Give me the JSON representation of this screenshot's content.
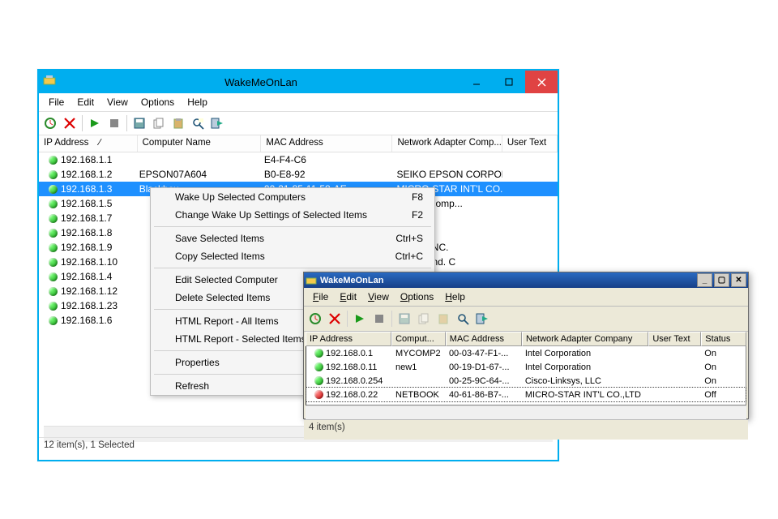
{
  "win1": {
    "title": "WakeMeOnLan",
    "menus": [
      "File",
      "Edit",
      "View",
      "Options",
      "Help"
    ],
    "columns": [
      "IP Address",
      "Computer Name",
      "MAC Address",
      "Network Adapter Comp...",
      "User Text"
    ],
    "rows": [
      {
        "ip": "192.168.1.1",
        "name": "",
        "mac": "E4-F4-C6",
        "net": "",
        "ut": "",
        "dot": "green",
        "sel": false
      },
      {
        "ip": "192.168.1.2",
        "name": "EPSON07A604",
        "mac": "B0-E8-92",
        "net": "SEIKO EPSON CORPORA...",
        "ut": "",
        "dot": "green",
        "sel": false
      },
      {
        "ip": "192.168.1.3",
        "name": "Blackbox",
        "mac": "00-21-85-11-58-AE",
        "net": "MICRO-STAR INT'L CO.,...",
        "ut": "",
        "dot": "green",
        "sel": true
      },
      {
        "ip": "192.168.1.5",
        "name": "",
        "mac": "",
        "net": "ackard Comp...",
        "ut": "",
        "dot": "green",
        "sel": false
      },
      {
        "ip": "192.168.1.7",
        "name": "",
        "mac": "",
        "net": "",
        "ut": "",
        "dot": "green",
        "sel": false
      },
      {
        "ip": "192.168.1.8",
        "name": "",
        "mac": "",
        "net": "",
        "ut": "",
        "dot": "green",
        "sel": false
      },
      {
        "ip": "192.168.1.9",
        "name": "",
        "mac": "",
        "net": "TEMS, INC.",
        "ut": "",
        "dot": "green",
        "sel": false
      },
      {
        "ip": "192.168.1.10",
        "name": "",
        "mac": "",
        "net": "ecision Ind. C",
        "ut": "",
        "dot": "green",
        "sel": false
      },
      {
        "ip": "192.168.1.4",
        "name": "",
        "mac": "",
        "net": "",
        "ut": "",
        "dot": "green",
        "sel": false
      },
      {
        "ip": "192.168.1.12",
        "name": "",
        "mac": "",
        "net": "",
        "ut": "",
        "dot": "green",
        "sel": false
      },
      {
        "ip": "192.168.1.23",
        "name": "",
        "mac": "",
        "net": "",
        "ut": "",
        "dot": "green",
        "sel": false
      },
      {
        "ip": "192.168.1.6",
        "name": "",
        "mac": "",
        "net": "",
        "ut": "",
        "dot": "green",
        "sel": false
      }
    ],
    "status": "12 item(s), 1 Selected"
  },
  "context_menu": [
    {
      "label": "Wake Up Selected Computers",
      "short": "F8"
    },
    {
      "label": "Change Wake Up Settings of Selected Items",
      "short": "F2"
    },
    {
      "sep": true
    },
    {
      "label": "Save Selected Items",
      "short": "Ctrl+S"
    },
    {
      "label": "Copy Selected Items",
      "short": "Ctrl+C"
    },
    {
      "sep": true
    },
    {
      "label": "Edit Selected Computer",
      "short": ""
    },
    {
      "label": "Delete Selected Items",
      "short": ""
    },
    {
      "sep": true
    },
    {
      "label": "HTML Report - All Items",
      "short": ""
    },
    {
      "label": "HTML Report - Selected Items",
      "short": ""
    },
    {
      "sep": true
    },
    {
      "label": "Properties",
      "short": ""
    },
    {
      "sep": true
    },
    {
      "label": "Refresh",
      "short": ""
    }
  ],
  "win2": {
    "title": "WakeMeOnLan",
    "menus": [
      "File",
      "Edit",
      "View",
      "Options",
      "Help"
    ],
    "columns": [
      "IP Address",
      "Comput...",
      "MAC Address",
      "Network Adapter Company",
      "User Text",
      "Status"
    ],
    "rows": [
      {
        "ip": "192.168.0.1",
        "name": "MYCOMP2",
        "mac": "00-03-47-F1-...",
        "net": "Intel Corporation",
        "ut": "",
        "st": "On",
        "dot": "green",
        "sel": false
      },
      {
        "ip": "192.168.0.11",
        "name": "new1",
        "mac": "00-19-D1-67-...",
        "net": "Intel Corporation",
        "ut": "",
        "st": "On",
        "dot": "green",
        "sel": false
      },
      {
        "ip": "192.168.0.254",
        "name": "",
        "mac": "00-25-9C-64-...",
        "net": "Cisco-Linksys, LLC",
        "ut": "",
        "st": "On",
        "dot": "green",
        "sel": false
      },
      {
        "ip": "192.168.0.22",
        "name": "NETBOOK",
        "mac": "40-61-86-B7-...",
        "net": "MICRO-STAR INT'L CO.,LTD",
        "ut": "",
        "st": "Off",
        "dot": "red",
        "sel": true
      }
    ],
    "status": "4 item(s)"
  },
  "toolbar_icons": [
    "scan-icon",
    "delete-icon",
    "play-icon",
    "stop-icon",
    "save-icon",
    "copy-icon",
    "paste-icon",
    "find-icon",
    "exit-icon"
  ]
}
